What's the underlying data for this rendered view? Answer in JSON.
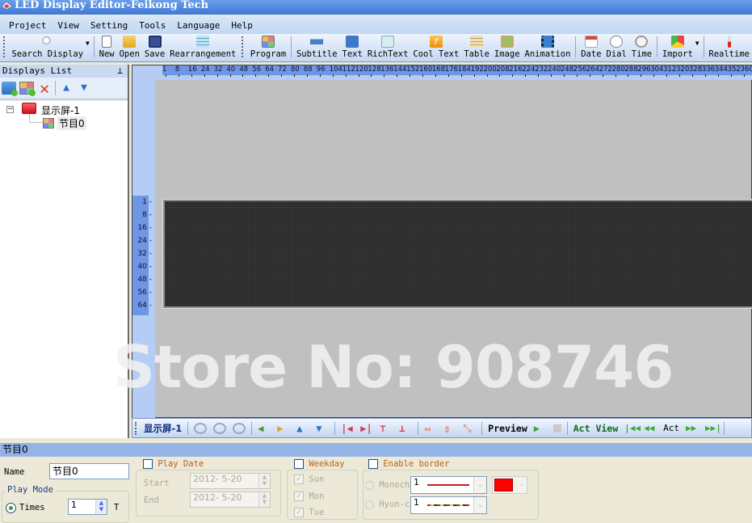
{
  "window": {
    "title": "LED Display Editor-Feikong Tech"
  },
  "menu": [
    "Project",
    "View",
    "Setting",
    "Tools",
    "Language",
    "Help"
  ],
  "toolbar": {
    "group1": [
      {
        "label": "Search Display",
        "icon": "search-icon"
      }
    ],
    "group2": [
      {
        "label": "New",
        "icon": "new-file-icon"
      },
      {
        "label": "Open",
        "icon": "open-folder-icon"
      },
      {
        "label": "Save",
        "icon": "save-icon"
      },
      {
        "label": "Rearrangement",
        "icon": "rearrange-icon"
      }
    ],
    "group3": [
      {
        "label": "Program",
        "icon": "program-icon"
      }
    ],
    "group4": [
      {
        "label": "Subtitle",
        "icon": "subtitle-icon"
      },
      {
        "label": "Text",
        "icon": "text-icon"
      },
      {
        "label": "RichText",
        "icon": "richtext-icon"
      },
      {
        "label": "Cool Text",
        "icon": "cool-text-icon"
      },
      {
        "label": "Table",
        "icon": "table-icon"
      },
      {
        "label": "Image",
        "icon": "image-icon"
      },
      {
        "label": "Animation",
        "icon": "animation-icon"
      }
    ],
    "group5": [
      {
        "label": "Date",
        "icon": "calendar-icon"
      },
      {
        "label": "Dial",
        "icon": "dial-clock-icon"
      },
      {
        "label": "Time",
        "icon": "time-icon"
      }
    ],
    "group6": [
      {
        "label": "Import",
        "icon": "import-icon"
      }
    ],
    "group7": [
      {
        "label": "Realtime",
        "icon": "thermometer-icon"
      }
    ]
  },
  "displays_list": {
    "title": "Displays List",
    "tree": {
      "display": "显示屏-1",
      "program": "节目0"
    }
  },
  "ruler": {
    "horizontal": [
      "1",
      "8",
      "16",
      "24",
      "32",
      "40",
      "48",
      "56",
      "64",
      "72",
      "80",
      "88",
      "96",
      "104",
      "112",
      "120",
      "128",
      "136",
      "144",
      "152",
      "160",
      "168",
      "176",
      "184",
      "192",
      "200",
      "208",
      "216",
      "224",
      "232",
      "240",
      "248",
      "256",
      "264",
      "272",
      "280",
      "288",
      "296",
      "304",
      "312",
      "320",
      "328",
      "336",
      "344",
      "352",
      "360"
    ],
    "vertical": [
      "1",
      "8",
      "16",
      "24",
      "32",
      "40",
      "48",
      "56",
      "64"
    ]
  },
  "watermark": "Store No: 908746",
  "workspace_toolbar": {
    "display_name": "显示屏-1",
    "preview_label": "Preview",
    "act_view_label": "Act View",
    "act_label": "Act"
  },
  "properties": {
    "header": "节目0",
    "name_label": "Name",
    "name_value": "节目0",
    "play_mode_title": "Play Mode",
    "times_label": "Times",
    "times_value": "1",
    "times_unit": "T",
    "play_date_title": "Play Date",
    "start_label": "Start",
    "start_value": "2012- 5-20",
    "end_label": "End",
    "end_value": "2012- 5-20",
    "weekday_title": "Weekday",
    "weekdays": [
      "Sun",
      "Mon",
      "Tue"
    ],
    "enable_border_title": "Enable border",
    "mono_label": "Monochr",
    "hyun_label": "Hyun-co",
    "mono_width": "1",
    "hyun_width": "1",
    "border_color": "#ff0000"
  }
}
